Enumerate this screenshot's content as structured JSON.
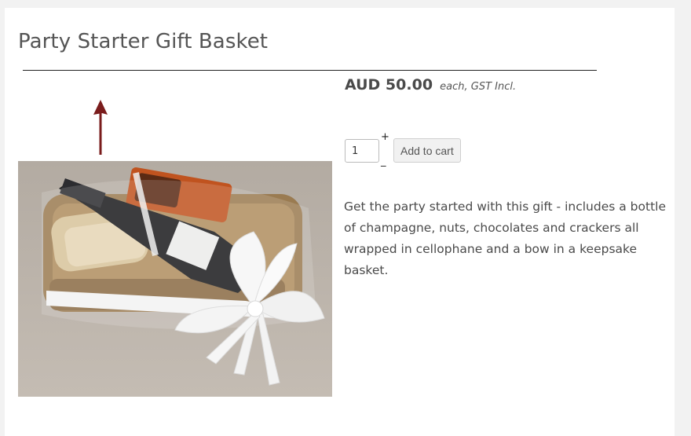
{
  "product": {
    "title": "Party Starter Gift Basket",
    "price": "AUD 50.00",
    "price_note": "each, GST Incl.",
    "quantity_value": "1",
    "qty_increase_label": "+",
    "qty_decrease_label": "_",
    "add_to_cart_label": "Add to cart",
    "description": "Get the party started with this gift - includes a bottle of champagne, nuts, chocolates and crackers all wrapped in cellophane and a bow in a keepsake basket."
  },
  "icons": {
    "pointer_arrow": "up-arrow-icon",
    "pointer_arrow_color": "#7a1c1c"
  }
}
